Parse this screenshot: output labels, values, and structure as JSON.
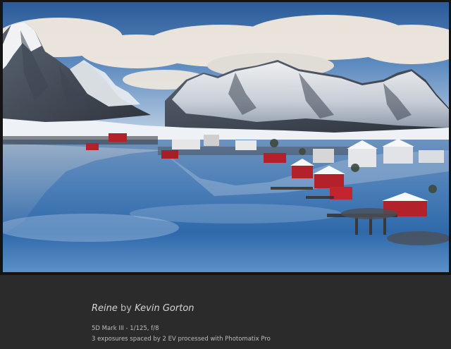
{
  "photo": {
    "subject": "snow-covered mountains, red and white houses, reflective water",
    "colors": {
      "sky_top": "#2f5f9c",
      "sky_low": "#cfdcea",
      "water_deep": "#1f5aa0",
      "water_light": "#9dc2e6",
      "house_red": "#b3222b",
      "snow": "#f2f4f7"
    }
  },
  "caption": {
    "title": "Reine",
    "by": "by",
    "photographer": "Kevin Gorton",
    "camera": "5D Mark III - 1/125, f/8",
    "processing": "3 exposures spaced by 2 EV processed with Photomatix Pro"
  }
}
